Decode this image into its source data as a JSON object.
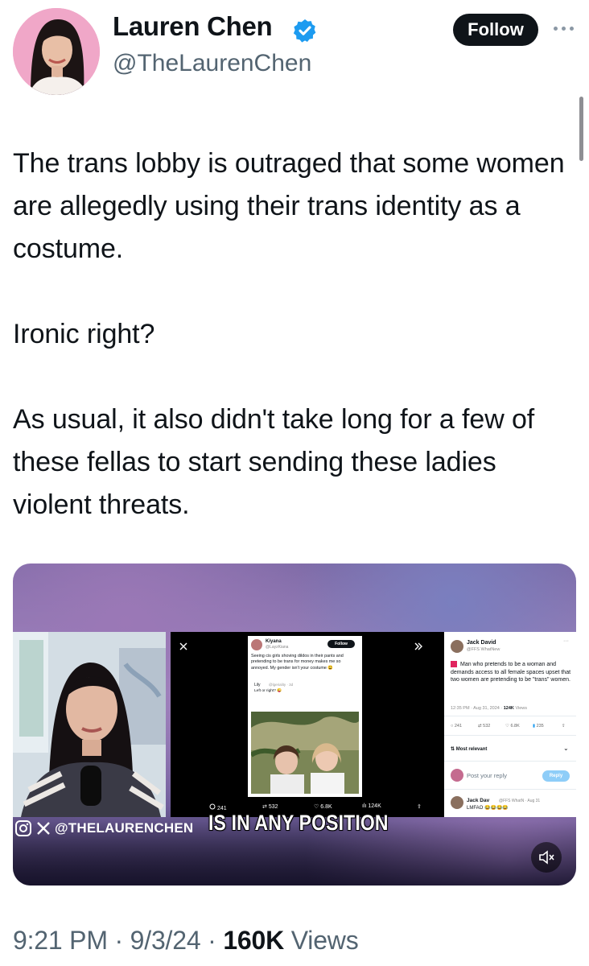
{
  "author": {
    "display_name": "Lauren Chen",
    "handle": "@TheLaurenChen",
    "verified": true
  },
  "header": {
    "follow_label": "Follow"
  },
  "tweet": {
    "paragraphs": [
      "The trans lobby is outraged that some women are allegedly using their trans identity as a costume.",
      "Ironic right?",
      "As usual, it also didn't take long for a few of these fellas to start sending these ladies violent threats."
    ]
  },
  "media": {
    "overlay_handle": "@THELAURENCHEN",
    "caption": "IS IN ANY POSITION",
    "inner_post": {
      "name": "Kiyana",
      "handle": "@LayzKiana",
      "follow_label": "Follow",
      "text": "Seeing cis girls shoving dildos in their pants and pretending to be trans for money makes me so annoyed. My gender isn't your costume 😩",
      "reply_name": "Lily",
      "reply_meta": "@lgeriality · 3d",
      "reply_text": "Left or right? 😜"
    },
    "inner_actions": {
      "replies": "241",
      "reposts": "532",
      "likes": "6.8K",
      "views": "124K"
    },
    "right_post": {
      "name": "Jack David",
      "handle": "@FFS WhatNew",
      "text": "Man who pretends to be a woman and demands access to all female spaces upset that two women are pretending to be \"trans\" women.",
      "time": "12:35 PM · Aug 31, 2024 ·",
      "views_count": "124K",
      "views_label": "Views",
      "replies": "241",
      "reposts": "532",
      "likes": "6.8K",
      "bookmarks": "235",
      "sort_label": "Most relevant",
      "reply_placeholder": "Post your reply",
      "reply_button": "Reply",
      "reply_name": "Jack Dav",
      "reply_meta": "@FFS WhatN · Aug 31",
      "reply_text": "LMFAO 😂😂😂😂"
    }
  },
  "footer": {
    "time": "9:21 PM",
    "separator": "·",
    "date": "9/3/24",
    "views_count": "160K",
    "views_label": "Views"
  },
  "colors": {
    "text": "#0f1419",
    "secondary": "#536471",
    "verified": "#1d9bf0",
    "button": "#0f1419"
  }
}
